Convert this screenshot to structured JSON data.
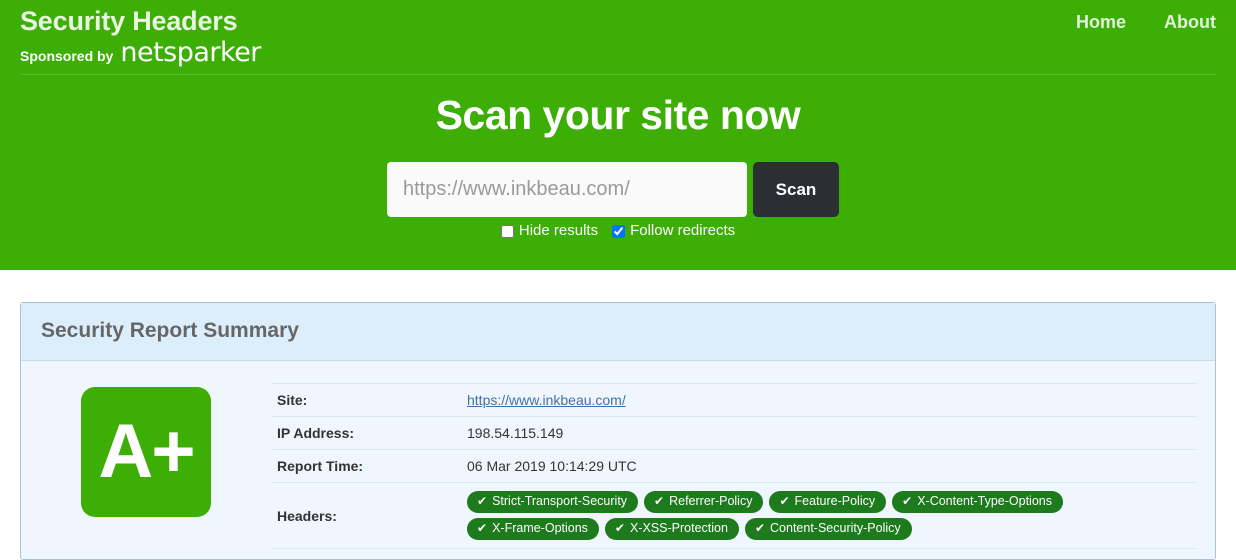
{
  "header": {
    "brand_title": "Security Headers",
    "sponsored_by": "Sponsored by",
    "sponsor_name": "netsparker",
    "nav": [
      {
        "label": "Home"
      },
      {
        "label": "About"
      }
    ]
  },
  "hero": {
    "heading": "Scan your site now",
    "url_placeholder": "https://www.inkbeau.com/",
    "url_value": "",
    "scan_button": "Scan",
    "options": [
      {
        "label": "Hide results",
        "checked": false
      },
      {
        "label": "Follow redirects",
        "checked": true
      }
    ]
  },
  "report": {
    "panel_title": "Security Report Summary",
    "grade": "A+",
    "rows": [
      {
        "key": "Site:",
        "value": "https://www.inkbeau.com/",
        "is_link": true
      },
      {
        "key": "IP Address:",
        "value": "198.54.115.149",
        "is_link": false
      },
      {
        "key": "Report Time:",
        "value": "06 Mar 2019 10:14:29 UTC",
        "is_link": false
      }
    ],
    "headers_label": "Headers:",
    "headers": [
      "Strict-Transport-Security",
      "Referrer-Policy",
      "Feature-Policy",
      "X-Content-Type-Options",
      "X-Frame-Options",
      "X-XSS-Protection",
      "Content-Security-Policy"
    ],
    "tick_glyph": "✔"
  },
  "colors": {
    "hero_green": "#3cae05",
    "badge_green": "#1d7a1d",
    "panel_header_blue": "#dceefc",
    "panel_body_blue": "#f0f6fd",
    "link_blue": "#3b73af",
    "scan_button_dark": "#2b2f33"
  }
}
